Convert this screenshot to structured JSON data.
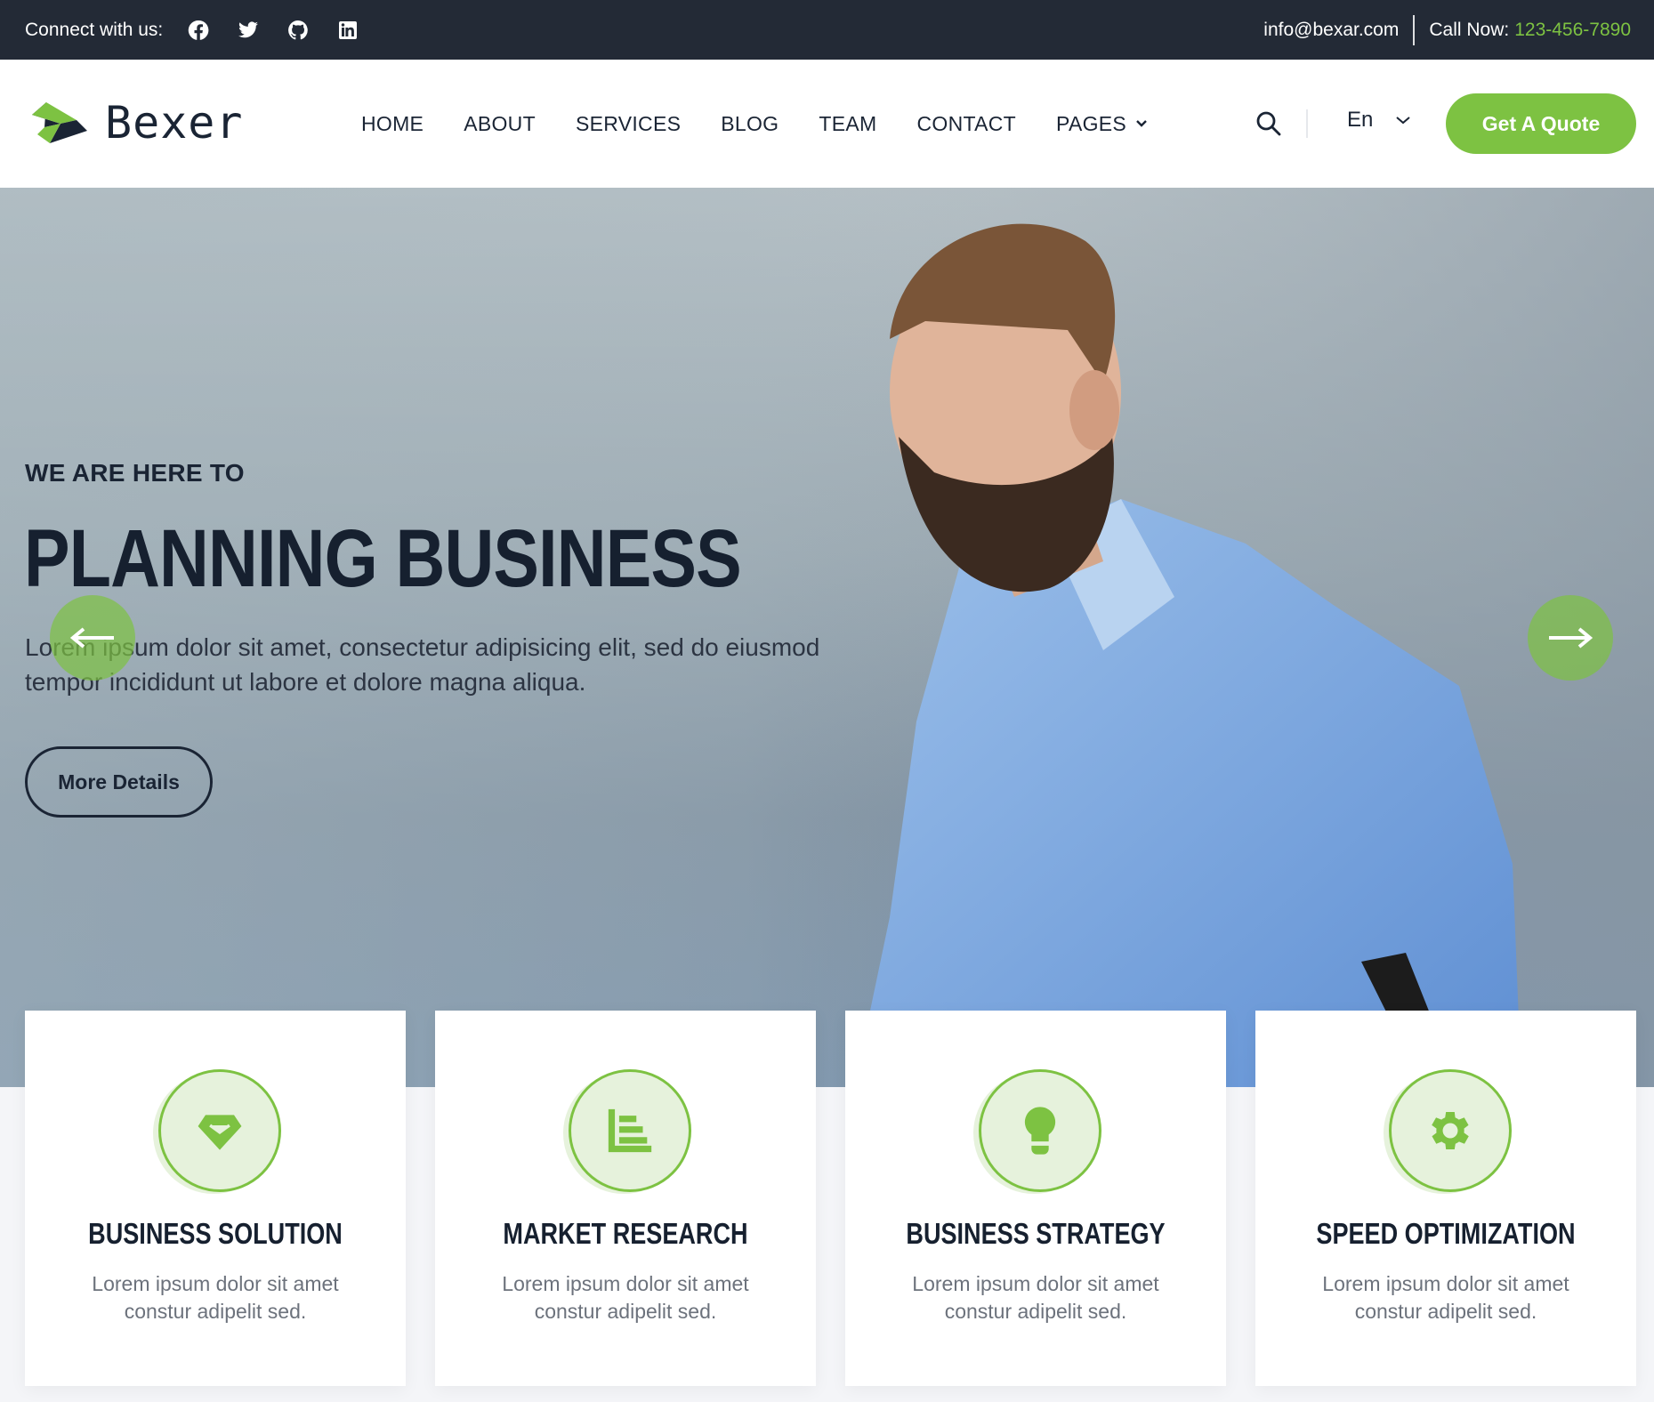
{
  "topbar": {
    "connect_label": "Connect with us:",
    "social_icons": [
      "facebook-icon",
      "twitter-icon",
      "github-icon",
      "linkedin-icon"
    ],
    "email": "info@bexar.com",
    "call_label": "Call Now:",
    "phone": "123-456-7890"
  },
  "header": {
    "logo_text": "Bexer",
    "nav": [
      "HOME",
      "ABOUT",
      "SERVICES",
      "BLOG",
      "TEAM",
      "CONTACT",
      "PAGES"
    ],
    "language": "En",
    "quote_button": "Get A Quote"
  },
  "hero": {
    "kicker": "WE ARE HERE TO",
    "title": "PLANNING BUSINESS",
    "description": "Lorem ipsum dolor sit amet, consectetur adipisicing elit, sed do eiusmod tempor incididunt ut labore et dolore magna aliqua.",
    "button": "More Details"
  },
  "features": [
    {
      "icon": "diamond-icon",
      "title": "BUSINESS SOLUTION",
      "text": "Lorem ipsum dolor sit amet constur adipelit sed."
    },
    {
      "icon": "bar-chart-icon",
      "title": "MARKET RESEARCH",
      "text": "Lorem ipsum dolor sit amet constur adipelit sed."
    },
    {
      "icon": "lightbulb-icon",
      "title": "BUSINESS STRATEGY",
      "text": "Lorem ipsum dolor sit amet constur adipelit sed."
    },
    {
      "icon": "gear-icon",
      "title": "SPEED OPTIMIZATION",
      "text": "Lorem ipsum dolor sit amet constur adipelit sed."
    }
  ],
  "colors": {
    "accent": "#7dc242",
    "dark": "#232a36",
    "heading": "#16202f"
  }
}
